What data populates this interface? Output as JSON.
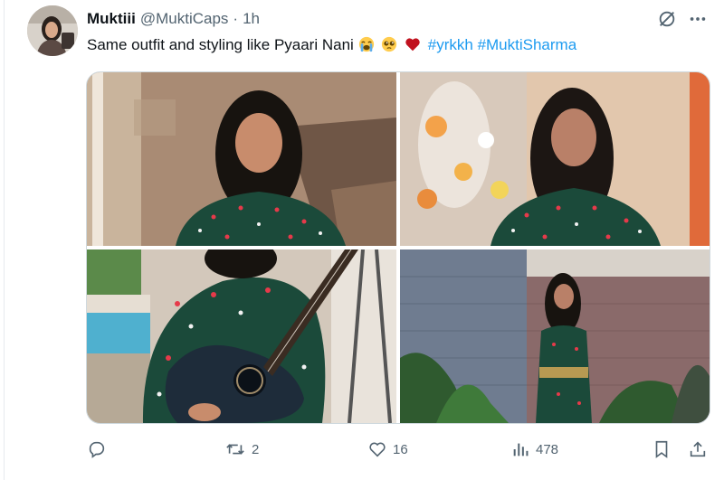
{
  "tweet": {
    "author": {
      "display_name": "Muktiii",
      "handle": "@MuktiCaps",
      "separator": "·",
      "time": "1h"
    },
    "text": {
      "body": "Same outfit and styling like Pyaari Nani ",
      "emojis": [
        "loudly-crying-face",
        "pleading-face",
        "red-heart"
      ],
      "hashtags": [
        "#yrkkh",
        "#MuktiSharma"
      ]
    },
    "media": {
      "photo_count": 4
    },
    "actions": {
      "reply_count": "",
      "repost_count": "2",
      "like_count": "16",
      "view_count": "478"
    }
  },
  "colors": {
    "text": "#0f1419",
    "secondary": "#536471",
    "link": "#1d9bf0",
    "outfit_green": "#1b4a3a",
    "heart_red": "#c1121f"
  },
  "icons": {
    "grok": "grok-icon",
    "more": "more-icon",
    "reply": "reply-icon",
    "repost": "repost-icon",
    "like": "like-icon",
    "views": "views-icon",
    "bookmark": "bookmark-icon",
    "share": "share-icon"
  }
}
